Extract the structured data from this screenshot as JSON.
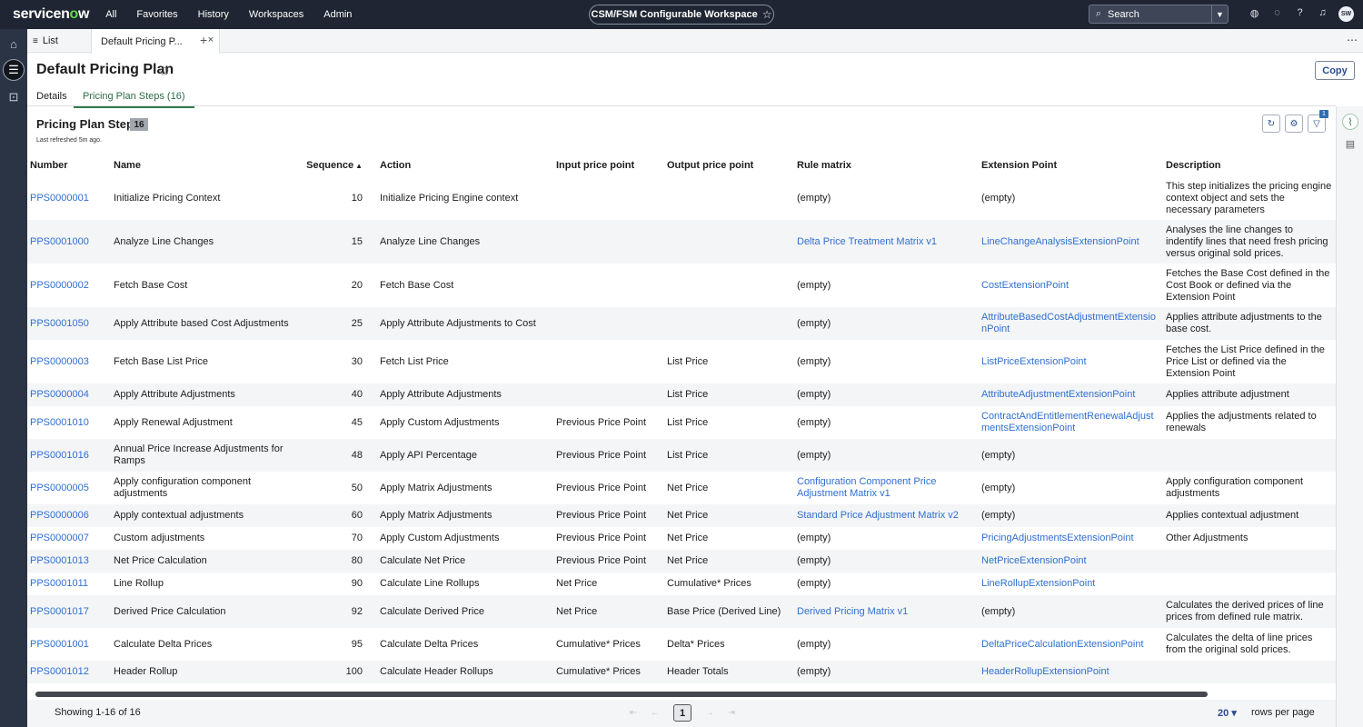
{
  "topnav": {
    "logo_pre": "servicen",
    "logo_o": "o",
    "logo_post": "w",
    "links": [
      "All",
      "Favorites",
      "History",
      "Workspaces",
      "Admin"
    ],
    "workspace": "CSM/FSM Configurable Workspace",
    "search_placeholder": "Search",
    "avatar_initials": "SW"
  },
  "tabs": {
    "list_label": "List",
    "active_label": "Default Pricing P..."
  },
  "page": {
    "title": "Default Pricing Plan",
    "copy_label": "Copy",
    "subtabs": [
      "Details",
      "Pricing Plan Steps (16)"
    ]
  },
  "list": {
    "title": "Pricing Plan Steps",
    "count": "16",
    "last_refreshed": "Last refreshed 5m ago.",
    "filter_count": "1",
    "columns": [
      "Number",
      "Name",
      "Sequence",
      "Action",
      "Input price point",
      "Output price point",
      "Rule matrix",
      "Extension Point",
      "Description"
    ],
    "rows": [
      {
        "number": "PPS0000001",
        "name": "Initialize Pricing Context",
        "sequence": "10",
        "action": "Initialize Pricing Engine context",
        "input": "",
        "output": "",
        "rule": "(empty)",
        "extension": "(empty)",
        "description": "This step initializes the pricing engine context object and sets the necessary parameters"
      },
      {
        "number": "PPS0001000",
        "name": "Analyze Line Changes",
        "sequence": "15",
        "action": "Analyze Line Changes",
        "input": "",
        "output": "",
        "rule": "Delta Price Treatment Matrix v1",
        "extension": "LineChangeAnalysisExtensionPoint",
        "description": "Analyses the line changes to indentify lines that need fresh pricing versus original sold prices."
      },
      {
        "number": "PPS0000002",
        "name": "Fetch Base Cost",
        "sequence": "20",
        "action": "Fetch Base Cost",
        "input": "",
        "output": "",
        "rule": "(empty)",
        "extension": "CostExtensionPoint",
        "description": "Fetches the Base Cost defined in the Cost Book or defined via the Extension Point"
      },
      {
        "number": "PPS0001050",
        "name": "Apply Attribute based Cost Adjustments",
        "sequence": "25",
        "action": "Apply Attribute Adjustments to Cost",
        "input": "",
        "output": "",
        "rule": "(empty)",
        "extension": "AttributeBasedCostAdjustmentExtensionPoint",
        "description": "Applies attribute adjustments to the base cost."
      },
      {
        "number": "PPS0000003",
        "name": "Fetch Base List Price",
        "sequence": "30",
        "action": "Fetch List Price",
        "input": "",
        "output": "List Price",
        "rule": "(empty)",
        "extension": "ListPriceExtensionPoint",
        "description": "Fetches the List Price defined in the Price List or defined via the Extension Point"
      },
      {
        "number": "PPS0000004",
        "name": "Apply Attribute Adjustments",
        "sequence": "40",
        "action": "Apply Attribute Adjustments",
        "input": "",
        "output": "List Price",
        "rule": "(empty)",
        "extension": "AttributeAdjustmentExtensionPoint",
        "description": "Applies attribute adjustment"
      },
      {
        "number": "PPS0001010",
        "name": "Apply Renewal Adjustment",
        "sequence": "45",
        "action": "Apply Custom Adjustments",
        "input": "Previous Price Point",
        "output": "List Price",
        "rule": "(empty)",
        "extension": "ContractAndEntitlementRenewalAdjustmentsExtensionPoint",
        "description": "Applies the adjustments related to renewals"
      },
      {
        "number": "PPS0001016",
        "name": "Annual Price Increase Adjustments for Ramps",
        "sequence": "48",
        "action": "Apply API Percentage",
        "input": "Previous Price Point",
        "output": "List Price",
        "rule": "(empty)",
        "extension": "(empty)",
        "description": ""
      },
      {
        "number": "PPS0000005",
        "name": "Apply configuration component adjustments",
        "sequence": "50",
        "action": "Apply Matrix Adjustments",
        "input": "Previous Price Point",
        "output": "Net Price",
        "rule": "Configuration Component Price Adjustment Matrix v1",
        "extension": "(empty)",
        "description": "Apply configuration component adjustments"
      },
      {
        "number": "PPS0000006",
        "name": "Apply contextual adjustments",
        "sequence": "60",
        "action": "Apply Matrix Adjustments",
        "input": "Previous Price Point",
        "output": "Net Price",
        "rule": "Standard Price Adjustment Matrix v2",
        "extension": "(empty)",
        "description": "Applies contextual adjustment"
      },
      {
        "number": "PPS0000007",
        "name": "Custom adjustments",
        "sequence": "70",
        "action": "Apply Custom Adjustments",
        "input": "Previous Price Point",
        "output": "Net Price",
        "rule": "(empty)",
        "extension": "PricingAdjustmentsExtensionPoint",
        "description": "Other Adjustments"
      },
      {
        "number": "PPS0001013",
        "name": "Net Price Calculation",
        "sequence": "80",
        "action": "Calculate Net Price",
        "input": "Previous Price Point",
        "output": "Net Price",
        "rule": "(empty)",
        "extension": "NetPriceExtensionPoint",
        "description": ""
      },
      {
        "number": "PPS0001011",
        "name": "Line Rollup",
        "sequence": "90",
        "action": "Calculate Line Rollups",
        "input": "Net Price",
        "output": "Cumulative* Prices",
        "rule": "(empty)",
        "extension": "LineRollupExtensionPoint",
        "description": ""
      },
      {
        "number": "PPS0001017",
        "name": "Derived Price Calculation",
        "sequence": "92",
        "action": "Calculate Derived Price",
        "input": "Net Price",
        "output": "Base Price (Derived Line)",
        "rule": "Derived Pricing Matrix v1",
        "extension": "(empty)",
        "description": "Calculates the derived prices of line prices from defined rule matrix."
      },
      {
        "number": "PPS0001001",
        "name": "Calculate Delta Prices",
        "sequence": "95",
        "action": "Calculate Delta Prices",
        "input": "Cumulative* Prices",
        "output": "Delta* Prices",
        "rule": "(empty)",
        "extension": "DeltaPriceCalculationExtensionPoint",
        "description": "Calculates the delta of line prices from the original sold prices."
      },
      {
        "number": "PPS0001012",
        "name": "Header Rollup",
        "sequence": "100",
        "action": "Calculate Header Rollups",
        "input": "Cumulative* Prices",
        "output": "Header Totals",
        "rule": "(empty)",
        "extension": "HeaderRollupExtensionPoint",
        "description": ""
      }
    ]
  },
  "footer": {
    "showing": "Showing 1-16 of 16",
    "page": "1",
    "rows_per_page_value": "20",
    "rows_per_page_label": "rows per page"
  }
}
